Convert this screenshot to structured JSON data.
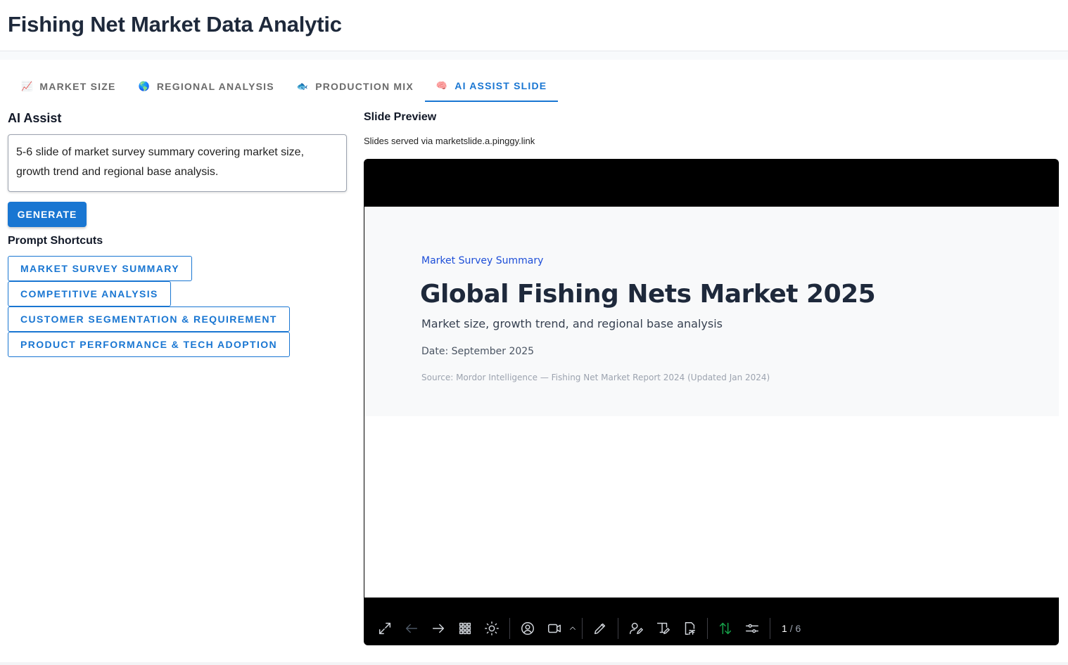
{
  "header": {
    "title": "Fishing Net Market Data Analytic"
  },
  "tabs": [
    {
      "label": "MARKET SIZE",
      "icon": "chart-up-icon",
      "glyph": "📈",
      "active": false
    },
    {
      "label": "REGIONAL ANALYSIS",
      "icon": "globe-icon",
      "glyph": "🌎",
      "active": false
    },
    {
      "label": "PRODUCTION MIX",
      "icon": "fish-icon",
      "glyph": "🐟",
      "active": false
    },
    {
      "label": "AI ASSIST SLIDE",
      "icon": "brain-icon",
      "glyph": "🧠",
      "active": true
    }
  ],
  "ai_assist": {
    "title": "AI Assist",
    "prompt_value": "5-6 slide of market survey summary covering market size, growth trend and regional base analysis.",
    "generate_label": "GENERATE",
    "shortcuts_title": "Prompt Shortcuts",
    "shortcuts": [
      "MARKET SURVEY SUMMARY",
      "COMPETITIVE ANALYSIS",
      "CUSTOMER SEGMENTATION & REQUIREMENT",
      "PRODUCT PERFORMANCE & TECH ADOPTION"
    ]
  },
  "preview": {
    "title": "Slide Preview",
    "served_text": "Slides served via marketslide.a.pinggy.link",
    "slide": {
      "eyebrow": "Market Survey Summary",
      "heading": "Global Fishing Nets Market 2025",
      "subtitle": "Market size, growth trend, and regional base analysis",
      "date": "Date: September 2025",
      "source": "Source: Mordor Intelligence — Fishing Net Market Report 2024 (Updated Jan 2024)"
    },
    "page": {
      "current": "1",
      "total": "/ 6"
    }
  },
  "colors": {
    "accent": "#1976d2",
    "slide_bg": "#f8f9fa",
    "frame": "#000000",
    "green": "#16a34a"
  }
}
